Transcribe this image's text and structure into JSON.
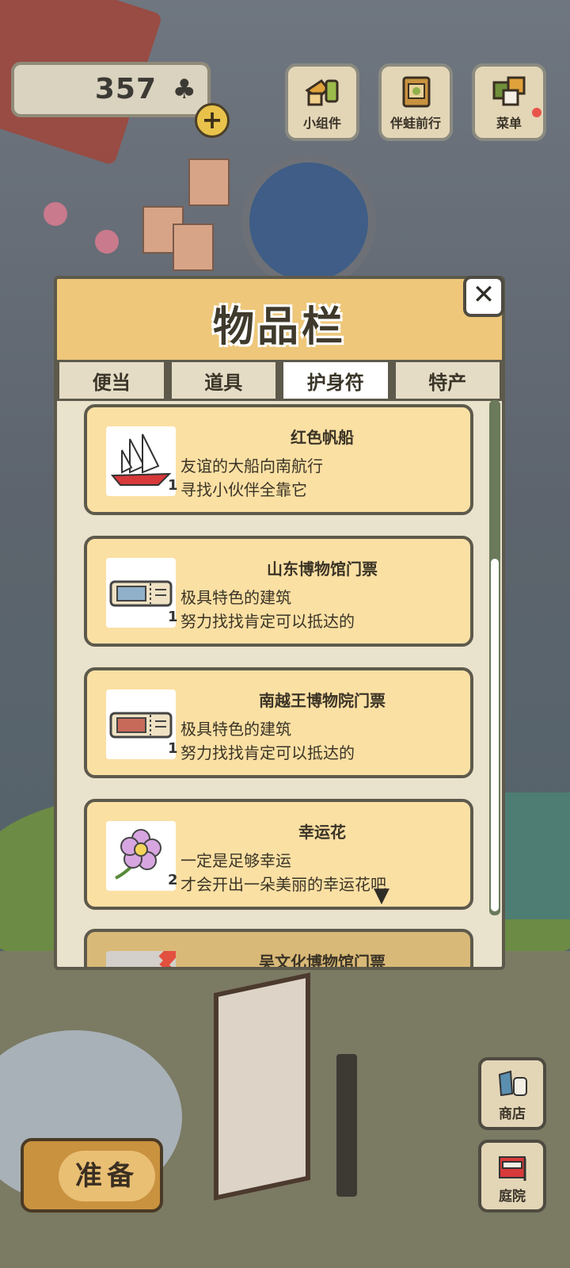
{
  "currency": {
    "value": "357",
    "icon": "clover-icon"
  },
  "top_buttons": [
    {
      "label": "小组件",
      "icon": "widget-icon"
    },
    {
      "label": "伴蛙前行",
      "icon": "frog-journey-icon"
    },
    {
      "label": "菜单",
      "icon": "menu-icon"
    }
  ],
  "modal": {
    "title": "物品栏",
    "tabs": [
      "便当",
      "道具",
      "护身符",
      "特产"
    ],
    "active_tab": "护身符",
    "items": [
      {
        "name": "红色帆船",
        "count": "1",
        "desc1": "友谊的大船向南航行",
        "desc2": "寻找小伙伴全靠它",
        "icon": "sailboat-icon"
      },
      {
        "name": "山东博物馆门票",
        "count": "1",
        "desc1": "极具特色的建筑",
        "desc2": "努力找找肯定可以抵达的",
        "icon": "ticket-icon"
      },
      {
        "name": "南越王博物院门票",
        "count": "1",
        "desc1": "极具特色的建筑",
        "desc2": "努力找找肯定可以抵达的",
        "icon": "ticket-icon"
      },
      {
        "name": "幸运花",
        "count": "2",
        "desc1": "一定是足够幸运",
        "desc2": "才会开出一朵美丽的幸运花吧",
        "icon": "flower-icon"
      },
      {
        "name": "吴文化博物馆门票",
        "icon": "checkmark-icon"
      }
    ]
  },
  "bottom": {
    "ready_label": "准备",
    "shop_label": "商店",
    "yard_label": "庭院"
  },
  "colors": {
    "panel_header": "#eec77a",
    "item_bg": "#fbe0a4",
    "border": "#5d5a4c"
  }
}
